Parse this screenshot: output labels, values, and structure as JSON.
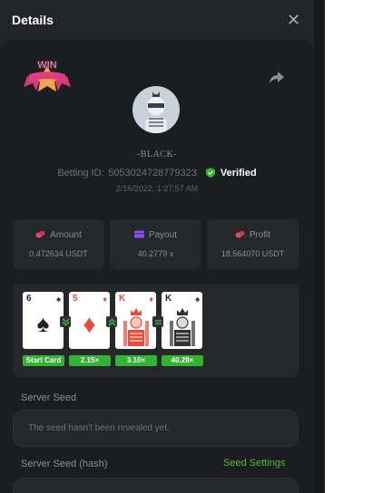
{
  "dialog": {
    "title": "Details"
  },
  "user": {
    "name": "-BLACK-",
    "betting_id_label": "Betting ID:",
    "betting_id": "5053024728779323",
    "verified_label": "Verified",
    "date": "2/16/2022, 1:27:57 AM"
  },
  "badge": {
    "text": "WIN"
  },
  "stats": [
    {
      "label": "Amount",
      "value": "0.472634 USDT",
      "icon": "coins-icon",
      "color": "#e74c5c"
    },
    {
      "label": "Payout",
      "value": "40.2779 x",
      "icon": "wallet-icon",
      "color": "#8e4ff0"
    },
    {
      "label": "Profit",
      "value": "18.564070 USDT",
      "icon": "coins-icon",
      "color": "#e74c5c"
    }
  ],
  "cards": [
    {
      "rank": "6",
      "suit": "♠",
      "color": "#222222",
      "multiplier": "Start Card"
    },
    {
      "rank": "5",
      "suit": "♦",
      "color": "#e74c3c",
      "multiplier": "2.15×"
    },
    {
      "rank": "K",
      "suit": "♦",
      "color": "#e74c3c",
      "multiplier": "3.10×"
    },
    {
      "rank": "K",
      "suit": "♠",
      "color": "#222222",
      "multiplier": "40.28×"
    }
  ],
  "seeds": {
    "server_seed_label": "Server Seed",
    "server_seed_value": "The seed hasn't been revealed yet.",
    "server_seed_hash_label": "Server Seed (hash)",
    "seed_settings_label": "Seed Settings"
  },
  "colors": {
    "accent": "#4cba35",
    "panel": "#232427",
    "surface": "#26272b"
  }
}
